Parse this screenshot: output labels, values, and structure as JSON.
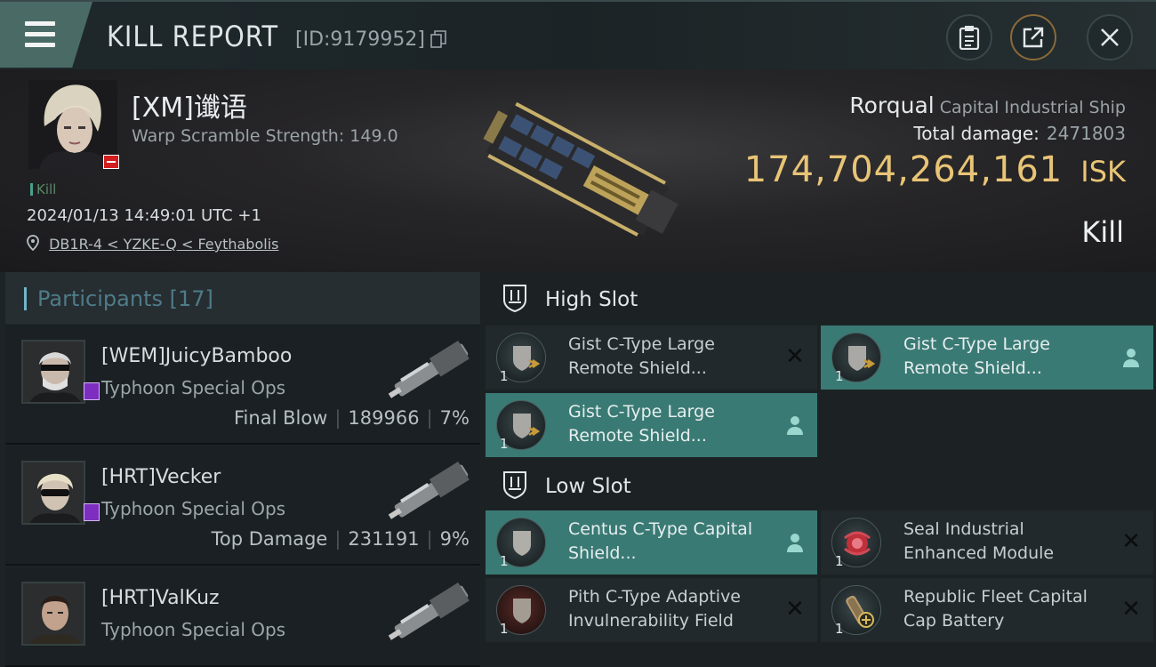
{
  "header": {
    "title": "KILL REPORT",
    "id_label": "[ID:9179952]"
  },
  "victim": {
    "name": "[XM]谶语",
    "warp_scramble": "Warp Scramble Strength: 149.0",
    "tag": "Kill",
    "datetime": "2024/01/13 14:49:01 UTC +1",
    "location": "DB1R-4 < YZKE-Q < Feythabolis"
  },
  "ship": {
    "name": "Rorqual",
    "class": "Capital Industrial Ship",
    "total_damage_label": "Total damage:",
    "total_damage": "2471803",
    "isk_value": "174,704,264,161",
    "isk_unit": "ISK",
    "result": "Kill"
  },
  "participants": {
    "title": "Participants",
    "count": "[17]",
    "list": [
      {
        "name": "[WEM]JuicyBamboo",
        "ship": "Typhoon Special Ops",
        "label": "Final Blow",
        "damage": "189966",
        "percent": "7%"
      },
      {
        "name": "[HRT]Vecker",
        "ship": "Typhoon Special Ops",
        "label": "Top Damage",
        "damage": "231191",
        "percent": "9%"
      },
      {
        "name": "[HRT]ValKuz",
        "ship": "Typhoon Special Ops",
        "label": "",
        "damage": "",
        "percent": ""
      }
    ]
  },
  "slots": {
    "high": {
      "title": "High Slot",
      "modules": [
        {
          "name": "Gist C-Type Large Remote Shield...",
          "qty": "1",
          "status": "destroyed"
        },
        {
          "name": "Gist C-Type Large Remote Shield...",
          "qty": "1",
          "status": "dropped"
        },
        {
          "name": "Gist C-Type Large Remote Shield...",
          "qty": "1",
          "status": "dropped"
        }
      ]
    },
    "low": {
      "title": "Low Slot",
      "modules": [
        {
          "name": "Centus C-Type Capital Shield...",
          "qty": "1",
          "status": "dropped"
        },
        {
          "name": "Seal Industrial Enhanced Module",
          "qty": "1",
          "status": "destroyed"
        },
        {
          "name": "Pith C-Type Adaptive Invulnerability Field",
          "qty": "1",
          "status": "destroyed"
        },
        {
          "name": "Republic Fleet Capital Cap Battery",
          "qty": "1",
          "status": "destroyed"
        }
      ]
    }
  },
  "colors": {
    "accent_teal": "#3a7a74",
    "isk_gold": "#e8c476",
    "participants_title": "#4f7b88"
  },
  "icons": [
    "menu-icon",
    "copy-icon",
    "clipboard-icon",
    "share-icon",
    "close-icon",
    "location-pin-icon",
    "slot-high-icon",
    "slot-low-icon",
    "person-icon",
    "destroyed-x-icon"
  ]
}
